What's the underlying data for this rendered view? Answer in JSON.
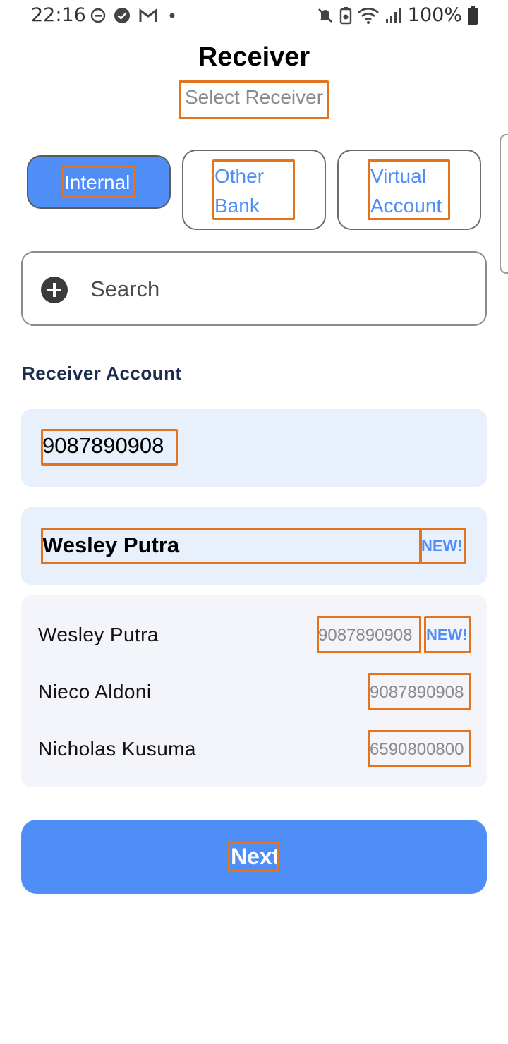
{
  "status_bar": {
    "time": "22:16",
    "battery": "100%",
    "left_icons": [
      "do-not-disturb-icon",
      "check-circle-icon",
      "gmail-icon",
      "notification-dot-icon"
    ],
    "right_icons": [
      "mute-icon",
      "battery-saver-icon",
      "wifi-icon",
      "signal-icon",
      "battery-icon"
    ]
  },
  "header": {
    "title": "Receiver",
    "subtitle": "Select Receiver"
  },
  "tabs": [
    {
      "line1": "Internal",
      "line2": "",
      "active": true
    },
    {
      "line1": "Other",
      "line2": "Bank",
      "active": false
    },
    {
      "line1": "Virtual",
      "line2": "Account",
      "active": false
    }
  ],
  "search": {
    "placeholder": "Search",
    "icon": "plus-circle-icon"
  },
  "receiver_account": {
    "label": "Receiver Account",
    "account_number": "9087890908",
    "account_name": "Wesley Putra",
    "badge": "NEW!"
  },
  "receivers": [
    {
      "name": "Wesley Putra",
      "number": "9087890908",
      "badge": "NEW!"
    },
    {
      "name": "Nieco Aldoni",
      "number": "9087890908",
      "badge": ""
    },
    {
      "name": "Nicholas Kusuma",
      "number": "6590800800",
      "badge": ""
    }
  ],
  "next_button": {
    "label": "Next"
  },
  "colors": {
    "accent": "#4f8ef7",
    "field_bg": "#e8f0fc",
    "list_bg": "#f3f5fa",
    "section_label": "#1d2b4f",
    "highlight_box": "#e3731c"
  }
}
